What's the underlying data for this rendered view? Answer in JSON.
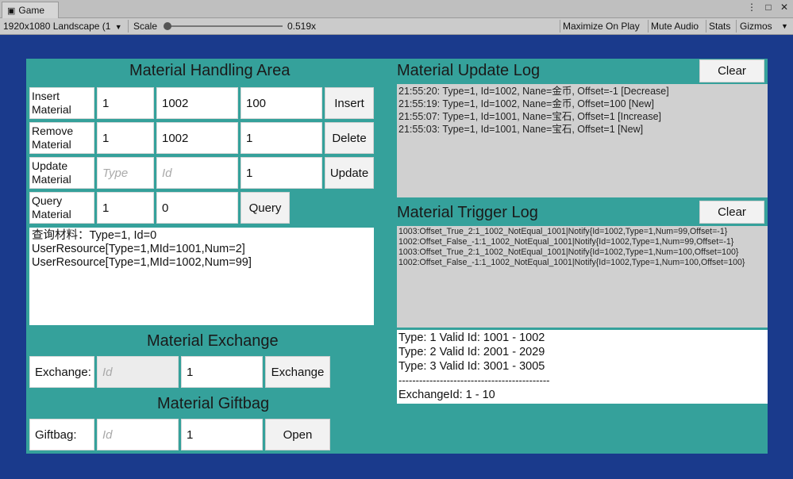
{
  "window": {
    "tab_label": "Game",
    "tab_icon": "gamepad-icon",
    "menu_icon": "kebab-menu-icon",
    "maximize_icon": "maximize-window-icon",
    "close_icon": "close-window-icon"
  },
  "toolbar": {
    "resolution": "1920x1080 Landscape (1",
    "scale_label": "Scale",
    "scale_value": "0.519x",
    "maximize": "Maximize On Play",
    "mute": "Mute Audio",
    "stats": "Stats",
    "gizmos": "Gizmos"
  },
  "handling": {
    "title": "Material Handling Area",
    "rows": [
      {
        "label": "Insert Material",
        "type": "1",
        "id": "1002",
        "value": "100",
        "button": "Insert"
      },
      {
        "label": "Remove Material",
        "type": "1",
        "id": "1002",
        "value": "1",
        "button": "Delete"
      },
      {
        "label": "Update Material",
        "type_placeholder": "Type",
        "id_placeholder": "Id",
        "value": "1",
        "button": "Update"
      }
    ],
    "query": {
      "label": "Query Material",
      "type": "1",
      "id": "0",
      "button": "Query"
    },
    "output": [
      "查询材料：Type=1, Id=0",
      "UserResource[Type=1,MId=1001,Num=2]",
      "UserResource[Type=1,MId=1002,Num=99]"
    ]
  },
  "exchange": {
    "title": "Material Exchange",
    "label": "Exchange:",
    "id_placeholder": "Id",
    "value": "1",
    "button": "Exchange"
  },
  "giftbag": {
    "title": "Material Giftbag",
    "label": "Giftbag:",
    "id_placeholder": "Id",
    "value": "1",
    "button": "Open"
  },
  "update_log": {
    "title": "Material Update Log",
    "clear": "Clear",
    "lines": [
      "21:55:20: Type=1, Id=1002, Nane=金币, Offset=-1 [Decrease]",
      "21:55:19: Type=1, Id=1002, Nane=金币, Offset=100 [New]",
      "21:55:07: Type=1, Id=1001, Nane=宝石, Offset=1 [Increase]",
      "21:55:03: Type=1, Id=1001, Nane=宝石, Offset=1 [New]"
    ]
  },
  "trigger_log": {
    "title": "Material Trigger Log",
    "clear": "Clear",
    "lines": [
      "1003:Offset_True_2:1_1002_NotEqual_1001|Notify{Id=1002,Type=1,Num=99,Offset=-1}",
      "1002:Offset_False_-1:1_1002_NotEqual_1001|Notify{Id=1002,Type=1,Num=99,Offset=-1}",
      "1003:Offset_True_2:1_1002_NotEqual_1001|Notify{Id=1002,Type=1,Num=100,Offset=100}",
      "1002:Offset_False_-1:1_1002_NotEqual_1001|Notify{Id=1002,Type=1,Num=100,Offset=100}"
    ]
  },
  "info": {
    "lines": [
      "Type: 1  Valid Id: 1001 - 1002",
      "Type: 2  Valid Id: 2001 - 2029",
      "Type: 3  Valid Id: 3001 - 3005",
      "--------------------------------------------",
      "ExchangeId: 1 - 10"
    ]
  },
  "colors": {
    "panel": "#35a19b",
    "background": "#1a3a8c",
    "log_background": "#d0d0d0"
  }
}
